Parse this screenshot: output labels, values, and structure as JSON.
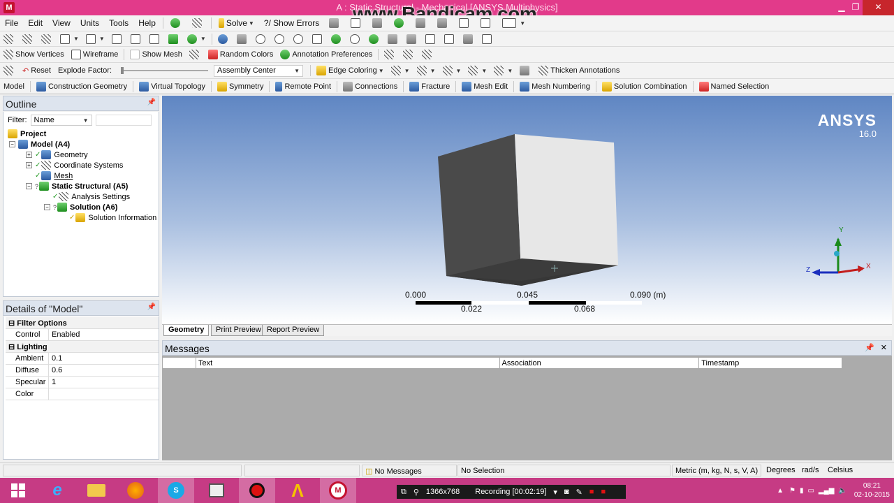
{
  "window": {
    "title": "A : Static Structural - Mechanical [ANSYS Multiphysics]",
    "watermark": "www.Bandicam.com",
    "app_icon": "M",
    "controls": [
      "minimize-icon",
      "restore-icon",
      "close-icon"
    ]
  },
  "menu": [
    "File",
    "Edit",
    "View",
    "Units",
    "Tools",
    "Help"
  ],
  "toolbar1": {
    "solve": "Solve",
    "show_errors": "?/ Show Errors"
  },
  "toolbar2": {
    "show_vertices": "Show Vertices",
    "wireframe": "Wireframe",
    "show_mesh": "Show Mesh",
    "random_colors": "Random Colors",
    "annotation_preferences": "Annotation Preferences"
  },
  "toolbar3": {
    "reset": "Reset",
    "explode_factor": "Explode Factor:",
    "assembly_center": "Assembly Center",
    "edge_coloring": "Edge Coloring",
    "thicken_annotations": "Thicken Annotations"
  },
  "context_toolbar": [
    "Model",
    "Construction Geometry",
    "Virtual Topology",
    "Symmetry",
    "Remote Point",
    "Connections",
    "Fracture",
    "Mesh Edit",
    "Mesh Numbering",
    "Solution Combination",
    "Named Selection"
  ],
  "outline": {
    "title": "Outline",
    "filter_label": "Filter:",
    "filter_value": "Name",
    "tree": {
      "project": "Project",
      "model": "Model (A4)",
      "geometry": "Geometry",
      "coordinate_systems": "Coordinate Systems",
      "mesh": "Mesh",
      "static_structural": "Static Structural (A5)",
      "analysis_settings": "Analysis Settings",
      "solution": "Solution (A6)",
      "solution_information": "Solution Information"
    }
  },
  "details": {
    "title": "Details of \"Model\"",
    "filter_group": "Filter Options",
    "control_label": "Control",
    "control_value": "Enabled",
    "lighting_group": "Lighting",
    "ambient_label": "Ambient",
    "ambient_value": "0.1",
    "diffuse_label": "Diffuse",
    "diffuse_value": "0.6",
    "specular_label": "Specular",
    "specular_value": "1",
    "color_label": "Color",
    "color_value": ""
  },
  "viewport": {
    "brand": "ANSYS",
    "version": "16.0",
    "scale": {
      "top_labels": [
        "0.000",
        "0.045",
        "0.090 (m)"
      ],
      "bottom_labels": [
        "0.022",
        "0.068"
      ]
    },
    "triad": {
      "x": "X",
      "y": "Y",
      "z": "Z"
    }
  },
  "view_tabs": [
    "Geometry",
    "Print Preview",
    "Report Preview"
  ],
  "messages": {
    "title": "Messages",
    "columns": [
      "Text",
      "Association",
      "Timestamp"
    ]
  },
  "statusbar": {
    "messages": "No Messages",
    "selection": "No Selection",
    "units": "Metric (m, kg, N, s, V, A)",
    "angle": "Degrees",
    "rotation": "rad/s",
    "temperature": "Celsius"
  },
  "recorder": {
    "resolution": "1366x768",
    "status": "Recording [00:02:19]"
  },
  "clock": {
    "time": "08:21",
    "date": "02-10-2015"
  },
  "colors": {
    "titlebar": "#e23a8a",
    "taskbar": "#c63b84",
    "viewport_top": "#5f86c3",
    "viewport_bottom": "#ffffff"
  }
}
